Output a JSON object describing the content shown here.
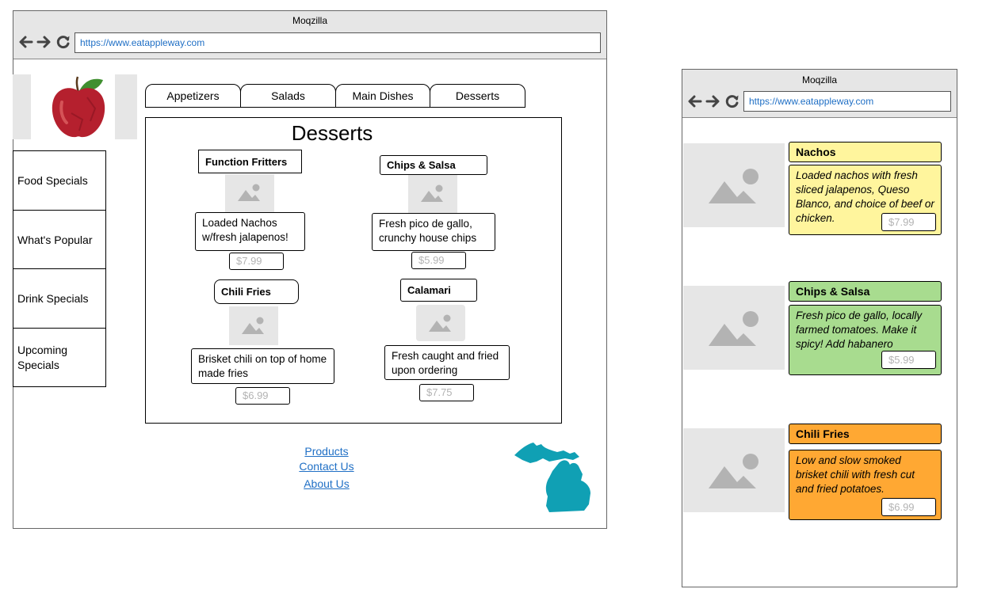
{
  "desktop": {
    "window_title": "Moqzilla",
    "url": "https://www.eatappleway.com",
    "sidebar": {
      "items": [
        {
          "label": "Food Specials"
        },
        {
          "label": "What's Popular"
        },
        {
          "label": "Drink Specials"
        },
        {
          "label": "Upcoming Specials"
        }
      ]
    },
    "tabs": [
      {
        "label": "Appetizers"
      },
      {
        "label": "Salads"
      },
      {
        "label": "Main Dishes"
      },
      {
        "label": "Desserts"
      }
    ],
    "panel": {
      "heading": "Desserts",
      "cards": [
        {
          "title": "Function Fritters",
          "description": "Loaded Nachos w/fresh jalapenos!",
          "price": "$7.99"
        },
        {
          "title": "Chips & Salsa",
          "description": "Fresh pico de gallo, crunchy house chips",
          "price": "$5.99"
        },
        {
          "title": "Chili Fries",
          "description": "Brisket chili on top of home made fries",
          "price": "$6.99"
        },
        {
          "title": "Calamari",
          "description": "Fresh caught and fried upon ordering",
          "price": "$7.75"
        }
      ]
    },
    "footer": {
      "links": [
        {
          "label": "Products"
        },
        {
          "label": "Contact Us"
        },
        {
          "label": "About Us"
        }
      ]
    }
  },
  "mobile": {
    "window_title": "Moqzilla",
    "url": "https://www.eatappleway.com",
    "items": [
      {
        "title": "Nachos",
        "description": "Loaded nachos with fresh sliced jalapenos, Queso Blanco, and choice of beef or chicken.",
        "price": "$7.99",
        "color": "#fff59d"
      },
      {
        "title": "Chips & Salsa",
        "description": "Fresh pico de gallo, locally farmed tomatoes. Make it spicy! Add habanero",
        "price": "$5.99",
        "color": "#a8dc8f"
      },
      {
        "title": "Chili Fries",
        "description": "Low and slow smoked brisket chili with fresh cut and fried potatoes.",
        "price": "$6.99",
        "color": "#ffa833"
      }
    ]
  },
  "colors": {
    "link": "#1f6fc5",
    "placeholder": "#e6e6e6",
    "michigan": "#10a0b4"
  }
}
